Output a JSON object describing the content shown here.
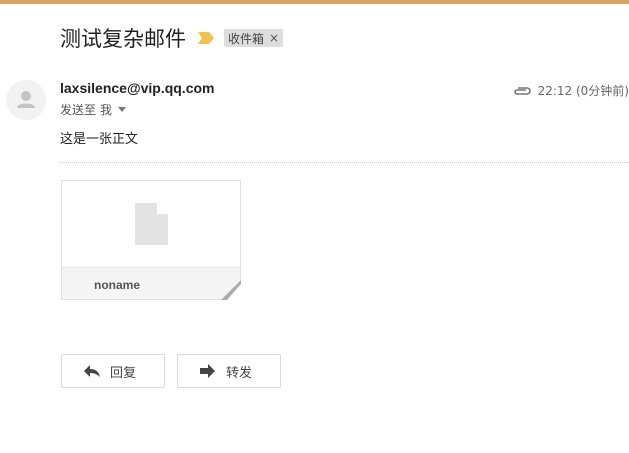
{
  "message": {
    "subject": "测试复杂邮件",
    "label": "收件箱",
    "label_close": "×",
    "sender": "laxsilence@vip.qq.com",
    "recipient_prefix": "发送至",
    "recipient": "我",
    "time": "22:12 (0分钟前)",
    "body": "这是一张正文"
  },
  "attachment": {
    "filename": "noname"
  },
  "actions": {
    "reply_label": "回复",
    "forward_label": "转发"
  },
  "icons": {
    "importance": "importance-marker-icon",
    "avatar": "person-avatar-icon",
    "paperclip": "paperclip-icon",
    "file": "file-icon",
    "reply": "reply-arrow-icon",
    "forward": "forward-arrow-icon"
  },
  "colors": {
    "top_bar": "#d9a35a",
    "importance": "#f3c24a",
    "label_chip": "#dddddd"
  }
}
